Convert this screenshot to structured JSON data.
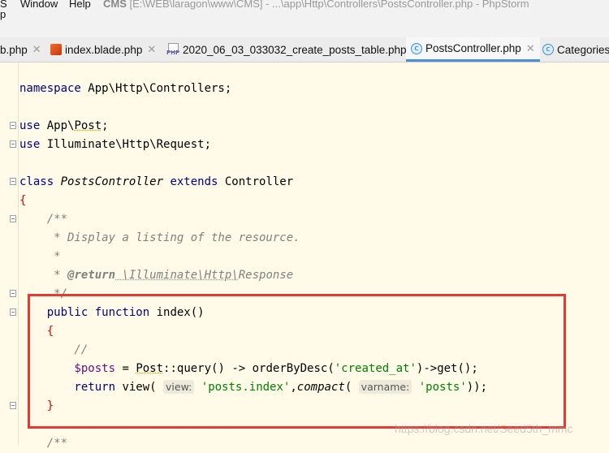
{
  "menu": {
    "items": [
      {
        "label": "S"
      },
      {
        "label": "Window"
      },
      {
        "label": "Help"
      }
    ],
    "window_title_app": "CMS",
    "window_title_rest": "[E:\\WEB\\laragon\\www\\CMS] - ...\\app\\Http\\Controllers\\PostsController.php - PhpStorm",
    "partial_menu": "p"
  },
  "tabs": [
    {
      "label": "b.php",
      "icon": "php-file-icon",
      "active": false
    },
    {
      "label": "index.blade.php",
      "icon": "blade-file-icon",
      "active": false
    },
    {
      "label": "2020_06_03_033032_create_posts_table.php",
      "icon": "php-file-icon",
      "active": false
    },
    {
      "label": "PostsController.php",
      "icon": "class-file-icon",
      "active": true
    },
    {
      "label": "Categories",
      "icon": "class-file-icon",
      "active": false
    }
  ],
  "code": {
    "l1_kw": "namespace",
    "l1_rest": " App\\Http\\Controllers;",
    "l2_kw": "use",
    "l2_a": " App\\",
    "l2_b": "Post",
    "l2_c": ";",
    "l3_kw": "use",
    "l3_rest": " Illuminate\\Http\\Request;",
    "l4_kw1": "class",
    "l4_name": " PostsController",
    "l4_kw2": " extends",
    "l4_rest": " Controller",
    "l5": "{",
    "l6": "    /**",
    "l7": "     * Display a listing of the resource.",
    "l8": "     *",
    "l9_a": "     * ",
    "l9_tag": "@return",
    "l9_b": " \\Illuminate\\Http\\",
    "l9_c": "Response",
    "l10": "     */",
    "l11_kw": "    public function",
    "l11_rest": " index()",
    "l12": "    {",
    "l13": "        //",
    "l14_var": "        $posts",
    "l14_a": " = ",
    "l14_cls": "Post",
    "l14_b": "::query() -> orderByDesc(",
    "l14_str": "'created_at'",
    "l14_c": ")->get();",
    "l15_kw": "        return",
    "l15_a": " view( ",
    "l15_hint1": "view:",
    "l15_str1": " 'posts.index'",
    "l15_b": ",",
    "l15_fn": "compact",
    "l15_c": "( ",
    "l15_hint2": "varname:",
    "l15_str2": " 'posts'",
    "l15_d": "));",
    "l16": "    }",
    "l17": "    /**"
  },
  "watermark": "https://blog.csdn.net/Seed5th_mmc",
  "colors": {
    "editor_bg": "#fffbe8",
    "keyword": "#000080",
    "string": "#008000",
    "variable": "#660e7a",
    "comment": "#808080",
    "highlight_box": "#e53935"
  }
}
